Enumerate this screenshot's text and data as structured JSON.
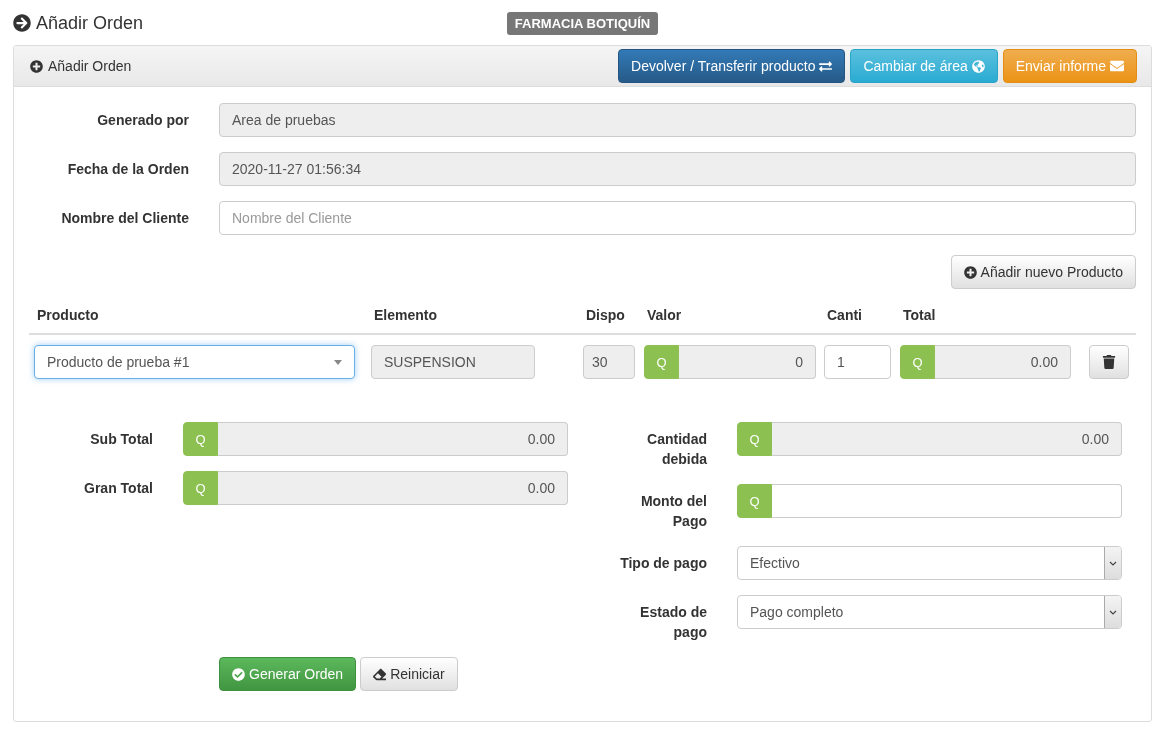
{
  "page_title": "Añadir Orden",
  "brand_badge": "FARMACIA BOTIQUÍN",
  "panel": {
    "title": "Añadir Orden",
    "actions": [
      {
        "label": "Devolver / Transferir producto",
        "kind": "primary"
      },
      {
        "label": "Cambiar de área",
        "kind": "info"
      },
      {
        "label": "Enviar informe",
        "kind": "warning"
      }
    ]
  },
  "header_fields": [
    {
      "label": "Generado por",
      "value": "Area de pruebas",
      "readonly": true
    },
    {
      "label": "Fecha de la Orden",
      "value": "2020-11-27 01:56:34",
      "readonly": true
    },
    {
      "label": "Nombre del Cliente",
      "placeholder": "Nombre del Cliente",
      "readonly": false
    }
  ],
  "add_product_button": "Añadir nuevo Producto",
  "product_table": {
    "columns": [
      "Producto",
      "Elemento",
      "Dispo",
      "Valor",
      "Canti",
      "Total"
    ],
    "rows": [
      {
        "product": "Producto de prueba #1",
        "element": "SUSPENSION",
        "available": "30",
        "value_prefix": "Q",
        "value": "0",
        "quantity": "1",
        "total_prefix": "Q",
        "total": "0.00"
      }
    ]
  },
  "totals_left": [
    {
      "label": "Sub Total",
      "prefix": "Q",
      "value": "0.00",
      "readonly": true
    },
    {
      "label": "Gran Total",
      "prefix": "Q",
      "value": "0.00",
      "readonly": true
    }
  ],
  "totals_right": [
    {
      "kind": "amount",
      "label": "Cantidad debida",
      "prefix": "Q",
      "value": "0.00",
      "readonly": true
    },
    {
      "kind": "amount",
      "label": "Monto del Pago",
      "prefix": "Q",
      "readonly": false
    },
    {
      "kind": "select",
      "label": "Tipo de pago",
      "value": "Efectivo"
    },
    {
      "kind": "select",
      "label": "Estado de pago",
      "value": "Pago completo"
    }
  ],
  "buttons": [
    {
      "label": "Generar Orden",
      "kind": "success"
    },
    {
      "label": "Reiniciar",
      "kind": "default"
    }
  ]
}
